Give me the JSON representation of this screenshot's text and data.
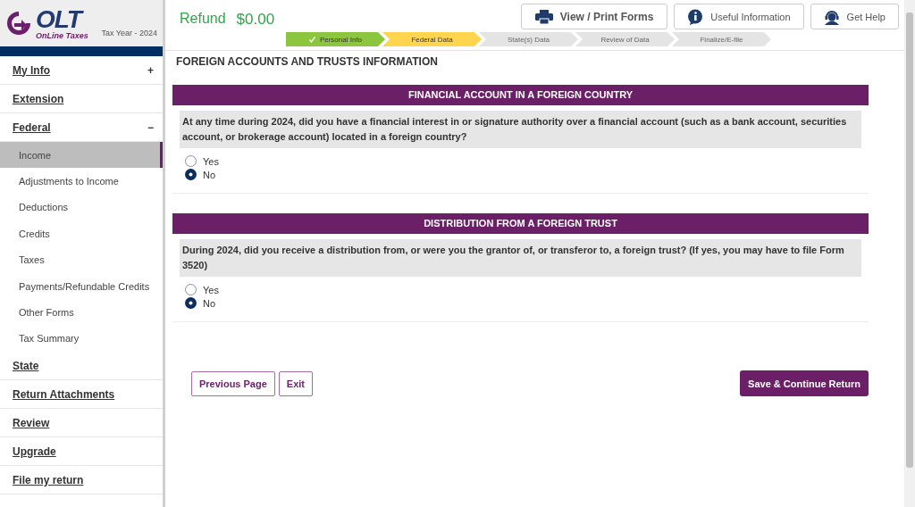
{
  "logo": {
    "brand": "OLT",
    "tagline": "OnLine Taxes",
    "tax_year": "Tax Year - 2024"
  },
  "refund": {
    "label": "Refund",
    "amount": "$0.00"
  },
  "header_buttons": [
    {
      "kind": "print",
      "label": "View / Print Forms"
    },
    {
      "kind": "info",
      "label": "Useful Information"
    },
    {
      "kind": "help",
      "label": "Get Help"
    }
  ],
  "steps": [
    {
      "label": "Personal Info",
      "completed": true,
      "selected": false
    },
    {
      "label": "Federal Data",
      "completed": false,
      "selected": true
    },
    {
      "label": "State(s) Data",
      "completed": false,
      "selected": false
    },
    {
      "label": "Review of Data",
      "completed": false,
      "selected": false
    },
    {
      "label": "Finalize/E-file",
      "completed": false,
      "selected": false
    }
  ],
  "sidebar": {
    "items": [
      {
        "label": "My Info",
        "toggle": "+"
      },
      {
        "label": "Extension"
      },
      {
        "label": "Federal",
        "toggle": "−",
        "children": [
          {
            "label": "Income",
            "selected": true
          },
          {
            "label": "Adjustments to Income",
            "selected": false
          },
          {
            "label": "Deductions",
            "selected": false
          },
          {
            "label": "Credits",
            "selected": false
          },
          {
            "label": "Taxes",
            "selected": false
          },
          {
            "label": "Payments/Refundable Credits",
            "selected": false
          },
          {
            "label": "Other Forms",
            "selected": false
          },
          {
            "label": "Tax Summary",
            "selected": false
          }
        ]
      },
      {
        "label": "State"
      },
      {
        "label": "Return Attachments"
      },
      {
        "label": "Review"
      },
      {
        "label": "Upgrade"
      },
      {
        "label": "File my return"
      }
    ]
  },
  "page_title": "FOREIGN ACCOUNTS AND TRUSTS INFORMATION",
  "sections": [
    {
      "title": "FINANCIAL ACCOUNT IN A FOREIGN COUNTRY",
      "question": "At any time during 2024, did you have a financial interest in or signature authority over a financial account (such as a bank account, securities account, or brokerage account) located in a foreign country?",
      "options": [
        {
          "label": "Yes",
          "selected": false
        },
        {
          "label": "No",
          "selected": true
        }
      ]
    },
    {
      "title": "DISTRIBUTION FROM A FOREIGN TRUST",
      "question": "During 2024, did you receive a distribution from, or were you the grantor of, or transferor to, a foreign trust? (If yes, you may have to file Form 3520)",
      "options": [
        {
          "label": "Yes",
          "selected": false
        },
        {
          "label": "No",
          "selected": true
        }
      ]
    }
  ],
  "footer_buttons": {
    "left": [
      "Previous Page",
      "Exit"
    ],
    "primary": "Save & Continue Return"
  }
}
